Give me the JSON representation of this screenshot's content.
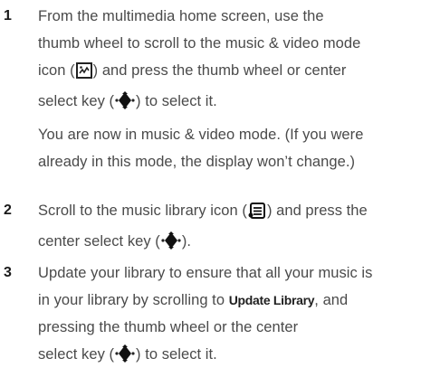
{
  "steps": [
    {
      "number": "1",
      "lines": {
        "l1": "From the multimedia home screen, use the",
        "l2": "thumb wheel to scroll to the music & video mode",
        "l3a": "icon (",
        "l3b": ") and press the thumb wheel or center",
        "l4a": "select key (",
        "l4b": ") to select it."
      },
      "note": {
        "l1": "You are now in music & video mode. (If you were",
        "l2": "already in this mode, the display won’t change.)"
      }
    },
    {
      "number": "2",
      "lines": {
        "l1a": "Scroll to the music library icon (",
        "l1b": ") and press the",
        "l2a": "center select key (",
        "l2b": ")."
      }
    },
    {
      "number": "3",
      "lines": {
        "l1": "Update your library to ensure that all your music is",
        "l2a": "in your library by scrolling to ",
        "l2bold": "Update Library",
        "l2b": ", and",
        "l3": "pressing the thumb wheel or the center",
        "l4a": "select key (",
        "l4b": ") to select it."
      }
    }
  ],
  "icons": {
    "music_video_mode": "music-video-mode-icon",
    "center_select_key": "center-select-key-icon",
    "music_library": "music-library-icon"
  }
}
